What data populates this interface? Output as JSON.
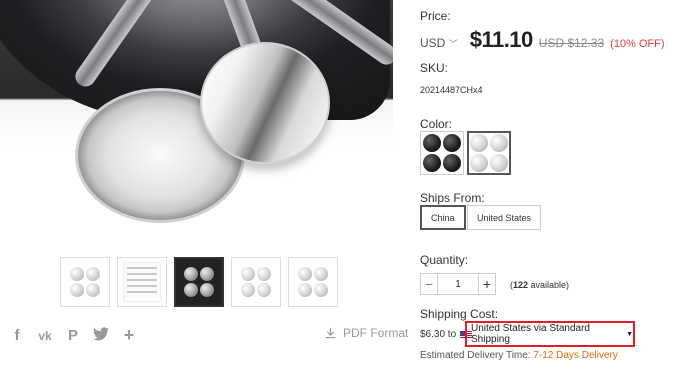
{
  "gallery": {
    "thumbnails": [
      {
        "kind": "caps-chrome"
      },
      {
        "kind": "document"
      },
      {
        "kind": "caps-wheel",
        "active": true
      },
      {
        "kind": "caps-chrome"
      },
      {
        "kind": "caps-chrome"
      }
    ],
    "share_icons": [
      "facebook-icon",
      "vk-icon",
      "pinterest-icon",
      "twitter-icon",
      "plus-icon"
    ],
    "pdf_label": "PDF Format"
  },
  "price": {
    "label": "Price:",
    "currency": "USD",
    "current": "$11.10",
    "original": "USD $12.33",
    "discount": "(10% OFF)"
  },
  "sku": {
    "label": "SKU:",
    "value": "20214487CHx4"
  },
  "color": {
    "label": "Color:",
    "options": [
      {
        "name": "black",
        "selected": false
      },
      {
        "name": "chrome",
        "selected": true
      }
    ]
  },
  "ships_from": {
    "label": "Ships From:",
    "options": [
      "China",
      "United States"
    ],
    "selected": "China"
  },
  "quantity": {
    "label": "Quantity:",
    "value": "1",
    "minus": "−",
    "plus": "+",
    "available_count": "122",
    "available_text": " available)",
    "available_prefix": "("
  },
  "shipping": {
    "label": "Shipping Cost:",
    "cost": "$6.30 to",
    "method": "United States via Standard Shipping",
    "eta_label": "Estimated Delivery Time:",
    "eta_days": "7-12 Days Delivery"
  },
  "colors": {
    "accent_red": "#e4393c",
    "highlight_border": "#e21d25",
    "eta_orange": "#e4690b"
  }
}
